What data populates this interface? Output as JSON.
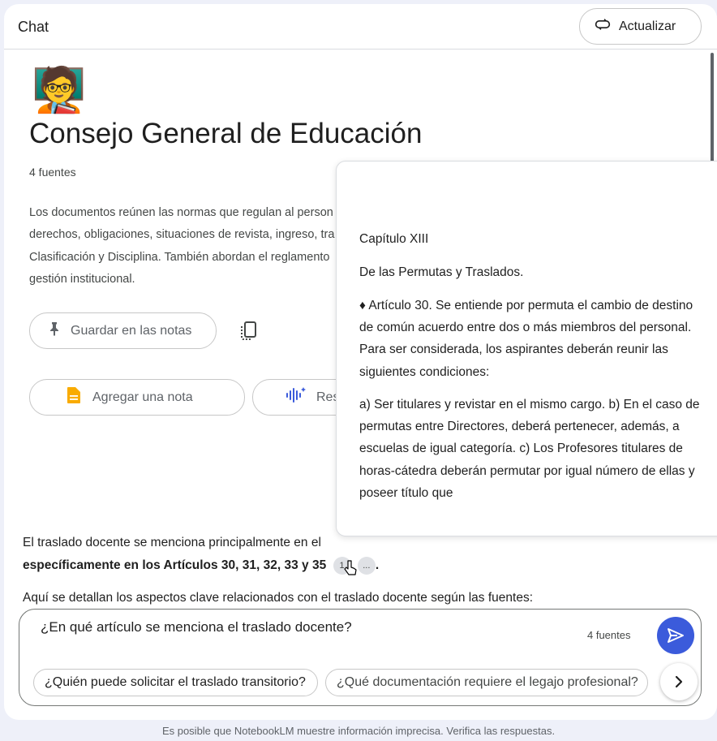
{
  "header": {
    "title": "Chat",
    "refresh_label": "Actualizar"
  },
  "notebook": {
    "emoji": "🧑‍🏫",
    "title": "Consejo General de Educación",
    "sources": "4 fuentes",
    "summary": [
      "Los documentos reúnen las normas que regulan al person",
      "derechos, obligaciones, situaciones de revista, ingreso, tra",
      "Clasificación y Disciplina. También abordan el reglamento",
      "gestión institucional."
    ]
  },
  "actions": {
    "save_note": "Guardar en las notas",
    "add_note": "Agregar una nota",
    "audio_overview": "Res"
  },
  "popover": {
    "paragraphs": [
      "Capítulo XIII",
      "De las Permutas y Traslados.",
      "♦ Artículo 30. Se entiende por permuta el cambio de destino de común acuerdo entre dos o más miembros del personal. Para ser considerada, los aspirantes deberán reunir las siguientes condiciones:",
      "a) Ser titulares y revistar en el mismo cargo. b) En el caso de permutas entre Directores, deberá pertenecer, además, a escuelas de igual categoría. c) Los Profesores titulares de horas-cátedra deberán permutar por igual número de ellas y poseer título que"
    ]
  },
  "answer": {
    "line1": "El traslado docente se menciona principalmente en el",
    "line2_bold": "específicamente en los Artículos 30, 31, 32, 33 y 35",
    "citation": "1",
    "more": "...",
    "line3": "Aquí se detallan los aspectos clave relacionados con el traslado docente según las fuentes:"
  },
  "composer": {
    "query": "¿En qué artículo se menciona el traslado docente?",
    "sources": "4 fuentes",
    "suggestions": [
      "¿Quién puede solicitar el traslado transitorio?",
      "¿Qué documentación requiere el legajo profesional?"
    ]
  },
  "footer": {
    "disclaimer": "Es posible que NotebookLM muestre información imprecisa. Verifica las respuestas."
  },
  "colors": {
    "accent": "#3b5bdb",
    "note_icon": "#f9ab00",
    "background": "#eef0f9"
  }
}
